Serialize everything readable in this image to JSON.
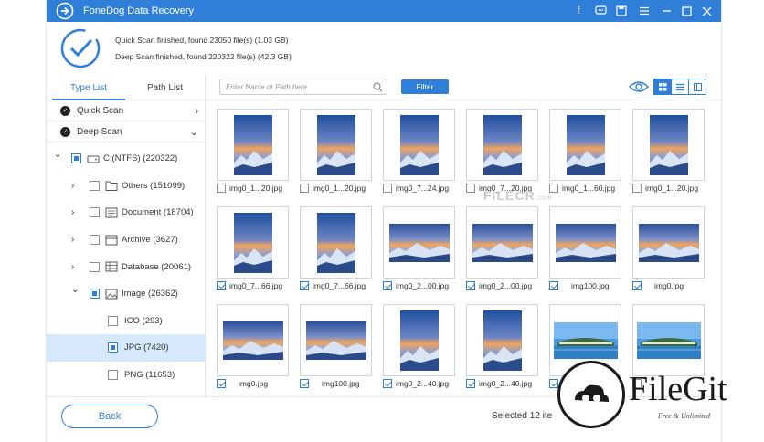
{
  "window": {
    "title": "FoneDog Data Recovery",
    "controls": [
      "facebook-icon",
      "chat-icon",
      "save-icon",
      "menu-icon",
      "minimize-icon",
      "maximize-icon",
      "close-icon"
    ]
  },
  "status": {
    "quick_scan": "Quick Scan finished, found 23050 file(s) (1.03 GB)",
    "deep_scan": "Deep Scan finished, found 220322 file(s) (42.3 GB)"
  },
  "left_panel": {
    "tabs": [
      "Type List",
      "Path List"
    ],
    "active_tab": "Type List",
    "scans": [
      {
        "label": "Quick Scan",
        "expanded": false
      },
      {
        "label": "Deep Scan",
        "expanded": true
      }
    ],
    "tree": [
      {
        "label": "C:(NTFS) (220322)",
        "level": 0,
        "icon": "drive-icon",
        "state": "partial"
      },
      {
        "label": "Others (151099)",
        "level": 1,
        "icon": "folder-icon",
        "state": "off"
      },
      {
        "label": "Document (18704)",
        "level": 1,
        "icon": "document-icon",
        "state": "off"
      },
      {
        "label": "Archive (3627)",
        "level": 1,
        "icon": "archive-icon",
        "state": "off"
      },
      {
        "label": "Database (20061)",
        "level": 1,
        "icon": "database-icon",
        "state": "off"
      },
      {
        "label": "Image (26362)",
        "level": 1,
        "icon": "image-icon",
        "state": "partial",
        "expanded": true
      },
      {
        "label": "ICO (293)",
        "level": 2,
        "state": "off"
      },
      {
        "label": "JPG (7420)",
        "level": 2,
        "state": "partial",
        "selected": true
      },
      {
        "label": "PNG (11653)",
        "level": 2,
        "state": "off"
      }
    ]
  },
  "toolbar": {
    "search_placeholder": "Enter Name or Path here",
    "filter_label": "Filter",
    "views": [
      "grid-view-icon",
      "list-view-icon",
      "detail-view-icon"
    ],
    "active_view": "grid-view-icon"
  },
  "files": [
    {
      "name": "img0_1...20.jpg",
      "checked": false,
      "thumb": "portrait"
    },
    {
      "name": "img0_1...20.jpg",
      "checked": false,
      "thumb": "portrait"
    },
    {
      "name": "img0_7...24.jpg",
      "checked": false,
      "thumb": "portrait"
    },
    {
      "name": "img0_7...20.jpg",
      "checked": false,
      "thumb": "portrait"
    },
    {
      "name": "img0_1...60.jpg",
      "checked": false,
      "thumb": "portrait"
    },
    {
      "name": "img0_1...20.jpg",
      "checked": false,
      "thumb": "portrait"
    },
    {
      "name": "img0_7...66.jpg",
      "checked": true,
      "thumb": "portrait"
    },
    {
      "name": "img0_7...66.jpg",
      "checked": true,
      "thumb": "portrait"
    },
    {
      "name": "img0_2...00.jpg",
      "checked": true,
      "thumb": "landscape"
    },
    {
      "name": "img0_2...00.jpg",
      "checked": true,
      "thumb": "landscape"
    },
    {
      "name": "img100.jpg",
      "checked": true,
      "thumb": "landscape"
    },
    {
      "name": "img0.jpg",
      "checked": true,
      "thumb": "landscape"
    },
    {
      "name": "img0.jpg",
      "checked": true,
      "thumb": "landscape"
    },
    {
      "name": "img100.jpg",
      "checked": true,
      "thumb": "landscape"
    },
    {
      "name": "img0_2...40.jpg",
      "checked": true,
      "thumb": "portrait"
    },
    {
      "name": "img0_2...40.jpg",
      "checked": true,
      "thumb": "portrait"
    },
    {
      "name": "",
      "checked": true,
      "thumb": "island"
    },
    {
      "name": "",
      "checked": false,
      "thumb": "island"
    }
  ],
  "bottom": {
    "back_label": "Back",
    "selected_text": "Selected 12 ite"
  },
  "watermarks": {
    "filecr": "FILECR",
    "filecr_suffix": ".com",
    "filegit_name": "FileGit",
    "filegit_tagline": "Free & Unlimited"
  },
  "colors": {
    "accent": "#2f7fd8",
    "selected_row": "#d6e8fb"
  }
}
